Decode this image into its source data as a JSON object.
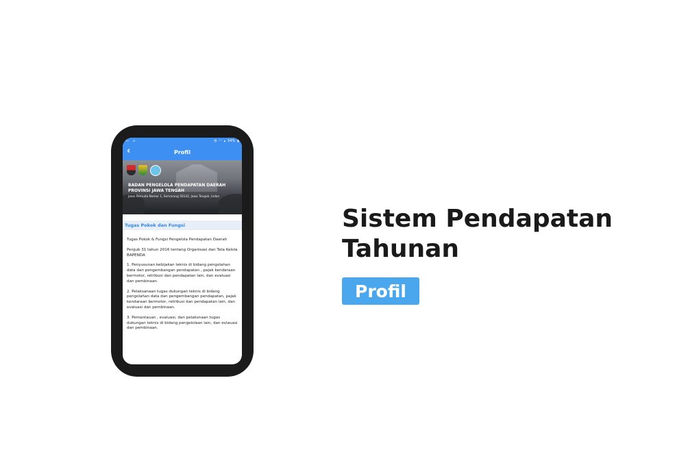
{
  "phone": {
    "statusbar": {
      "left_text": "",
      "right_text": "54%"
    },
    "appbar": {
      "back_icon": "chevron-left-icon",
      "title": "Profil"
    },
    "banner": {
      "title_line1": "BADAN PENGELOLA PENDAPATAN DAERAH",
      "title_line2": "PROVINSI JAWA TENGAH",
      "address": "Jalan Pemuda Nomor 1, Semarang 50142, Jawa Tengah, Indon"
    },
    "section": {
      "title": "Tugas Pokok dan Fungsi"
    },
    "paragraphs": [
      "Tugas Pokok & Fungsi Pengelola Pendapatan Daerah",
      "Pergub 31 tahun 2016 tentang Organisasi dan Tata Kelola BAPENDA",
      "1. Penyusunan kebijakan teknis di bidang pengolahan data dan pengembangan pendapatan , pajak kendaraan bermotor, retribusi dan pendapatan lain, dan evaluasi dan pembinaan.",
      "2. Pelaksanaan tugas dukungan teknis di bidang pengolahan data dan pengembangan pendapatan, pajak kendaraan bermotor, retribusi dan pendapatan lain, dan evaluasi dan pembinaan.",
      "3. Pemantauan , evaluasi, dan pelaksnaan tugas dukungan teknis di bidang pengelolaan lain, dan evlauasi dan pembinaan."
    ]
  },
  "headline": {
    "line1": "Sistem Pendapatan",
    "line2": "Tahunan"
  },
  "tag": {
    "label": "Profil"
  },
  "colors": {
    "accent": "#3e8ff2",
    "tag": "#4aa7ee",
    "section_title": "#2f86e8"
  }
}
